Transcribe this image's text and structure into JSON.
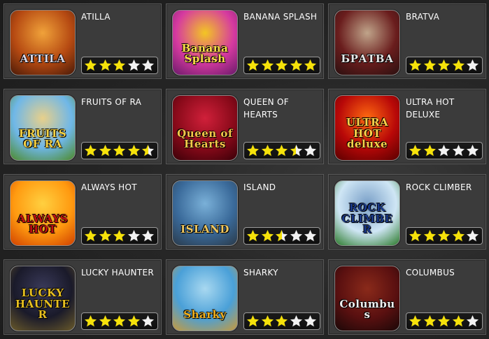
{
  "colors": {
    "star_filled": "#f6e20a",
    "star_empty": "#f2f2f2",
    "card_bg": "#3b3b3b",
    "title_text": "#ffffff"
  },
  "games": [
    {
      "title": "ATILLA",
      "thumb_text": "ATTILA",
      "rating": 3,
      "max_rating": 5,
      "thumb_icon": "attila-thumbnail",
      "thumb_colors": [
        "#b64a12",
        "#f0a23a",
        "#4a1a08"
      ],
      "text_color": "#d8d8e8"
    },
    {
      "title": "BANANA SPLASH",
      "thumb_text": "Banana Splash",
      "rating": 5,
      "max_rating": 5,
      "thumb_icon": "banana-splash-thumbnail",
      "thumb_colors": [
        "#d63aa0",
        "#f3c623",
        "#6a1a6a"
      ],
      "text_color": "#ffe14a"
    },
    {
      "title": "BRATVA",
      "thumb_text": "БРАТВА",
      "rating": 4,
      "max_rating": 5,
      "thumb_icon": "bratva-thumbnail",
      "thumb_colors": [
        "#6a1d1d",
        "#c0a48a",
        "#2a1010"
      ],
      "text_color": "#e8e8e8"
    },
    {
      "title": "FRUITS OF RA",
      "thumb_text": "FRUITS OF RA",
      "rating": 4.5,
      "max_rating": 5,
      "thumb_icon": "fruits-of-ra-thumbnail",
      "thumb_colors": [
        "#6fb7e8",
        "#e8d08a",
        "#4d8a2a"
      ],
      "text_color": "#f5d245"
    },
    {
      "title": "QUEEN OF HEARTS",
      "thumb_text": "Queen of Hearts",
      "rating": 3.5,
      "max_rating": 5,
      "thumb_icon": "queen-of-hearts-thumbnail",
      "thumb_colors": [
        "#8a0a1a",
        "#d0203a",
        "#3a0008"
      ],
      "text_color": "#f4c64a"
    },
    {
      "title": "ULTRA HOT DELUXE",
      "thumb_text": "ULTRA HOT deluxe",
      "rating": 2,
      "max_rating": 5,
      "thumb_icon": "ultra-hot-deluxe-thumbnail",
      "thumb_colors": [
        "#b80808",
        "#ff6a10",
        "#5a0000"
      ],
      "text_color": "#ffd24a"
    },
    {
      "title": "ALWAYS HOT",
      "thumb_text": "ALWAYS HOT",
      "rating": 3,
      "max_rating": 5,
      "thumb_icon": "always-hot-thumbnail",
      "thumb_colors": [
        "#ff9a10",
        "#ffd040",
        "#d04000"
      ],
      "text_color": "#c01010"
    },
    {
      "title": "ISLAND",
      "thumb_text": "ISLAND",
      "rating": 2.5,
      "max_rating": 5,
      "thumb_icon": "island-thumbnail",
      "thumb_colors": [
        "#3a6a9a",
        "#7ab0d8",
        "#2a3a4a"
      ],
      "text_color": "#f0c860"
    },
    {
      "title": "ROCK CLIMBER",
      "thumb_text": "ROCK CLIMBER",
      "rating": 4,
      "max_rating": 5,
      "thumb_icon": "rock-climber-thumbnail",
      "thumb_colors": [
        "#cfe6f5",
        "#7aa0c8",
        "#2a7a2a"
      ],
      "text_color": "#1a3a8a"
    },
    {
      "title": "LUCKY HAUNTER",
      "thumb_text": "LUCKY HAUNTER",
      "rating": 4,
      "max_rating": 5,
      "thumb_icon": "lucky-haunter-thumbnail",
      "thumb_colors": [
        "#1a1a2a",
        "#3a3a5a",
        "#6a5a2a"
      ],
      "text_color": "#e8c020"
    },
    {
      "title": "SHARKY",
      "thumb_text": "Sharky",
      "rating": 3,
      "max_rating": 5,
      "thumb_icon": "sharky-thumbnail",
      "thumb_colors": [
        "#4aa0d8",
        "#a8d8f0",
        "#c89a3a"
      ],
      "text_color": "#f0b020"
    },
    {
      "title": "COLUMBUS",
      "thumb_text": "Columbus",
      "rating": 4,
      "max_rating": 5,
      "thumb_icon": "columbus-thumbnail",
      "thumb_colors": [
        "#5a1010",
        "#8a2a1a",
        "#1a0808"
      ],
      "text_color": "#f0f0f0"
    }
  ]
}
